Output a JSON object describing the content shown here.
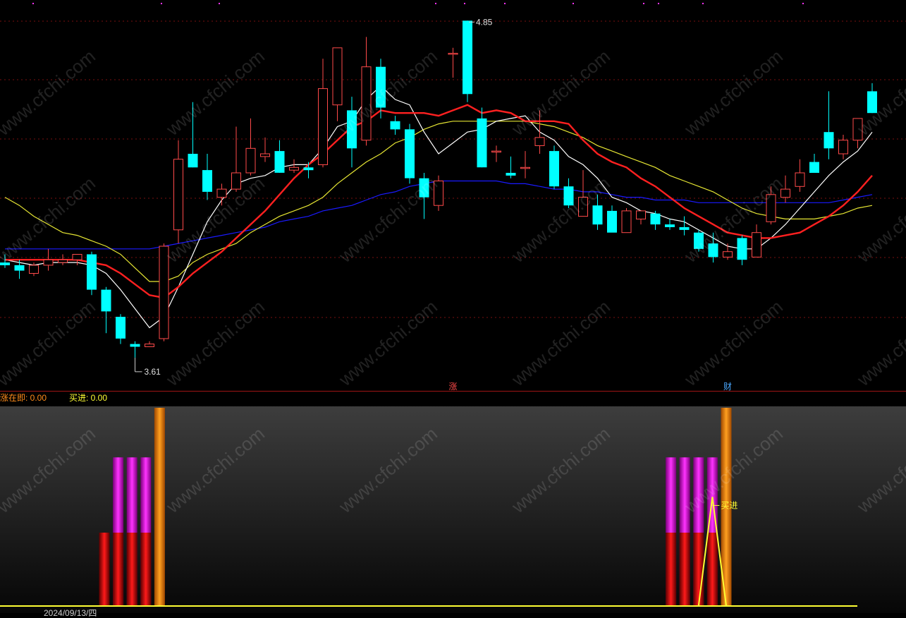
{
  "chart_data": [
    {
      "type": "candlestick",
      "ylim": [
        3.55,
        4.9
      ],
      "annotations": {
        "high_label": "4.85",
        "low_label": "3.61",
        "markers": [
          {
            "index": 31,
            "text": "涨"
          },
          {
            "index": 50,
            "text": "财"
          }
        ]
      },
      "grid": "dotted-horizontal",
      "colors": {
        "up": "#ff4a4a",
        "down": "#00ffff",
        "ma5": "#ffffff",
        "ma10": "#ff2020",
        "ma20": "#e6e633",
        "ma60": "#1a1aff"
      },
      "candles": [
        {
          "o": 3.96,
          "h": 3.99,
          "l": 3.94,
          "c": 3.95
        },
        {
          "o": 3.95,
          "h": 3.97,
          "l": 3.9,
          "c": 3.93
        },
        {
          "o": 3.92,
          "h": 3.96,
          "l": 3.91,
          "c": 3.95
        },
        {
          "o": 3.95,
          "h": 4.01,
          "l": 3.93,
          "c": 3.97
        },
        {
          "o": 3.96,
          "h": 3.99,
          "l": 3.95,
          "c": 3.97
        },
        {
          "o": 3.97,
          "h": 3.99,
          "l": 3.95,
          "c": 3.99
        },
        {
          "o": 3.99,
          "h": 4.0,
          "l": 3.84,
          "c": 3.86
        },
        {
          "o": 3.86,
          "h": 3.87,
          "l": 3.7,
          "c": 3.78
        },
        {
          "o": 3.76,
          "h": 3.77,
          "l": 3.66,
          "c": 3.68
        },
        {
          "o": 3.66,
          "h": 3.67,
          "l": 3.61,
          "c": 3.65
        },
        {
          "o": 3.65,
          "h": 3.67,
          "l": 3.65,
          "c": 3.66
        },
        {
          "o": 3.68,
          "h": 4.03,
          "l": 3.67,
          "c": 4.02
        },
        {
          "o": 4.08,
          "h": 4.41,
          "l": 4.03,
          "c": 4.34
        },
        {
          "o": 4.36,
          "h": 4.55,
          "l": 4.31,
          "c": 4.31
        },
        {
          "o": 4.3,
          "h": 4.36,
          "l": 4.19,
          "c": 4.22
        },
        {
          "o": 4.2,
          "h": 4.25,
          "l": 4.17,
          "c": 4.23
        },
        {
          "o": 4.23,
          "h": 4.46,
          "l": 4.22,
          "c": 4.29
        },
        {
          "o": 4.29,
          "h": 4.49,
          "l": 4.28,
          "c": 4.38
        },
        {
          "o": 4.35,
          "h": 4.42,
          "l": 4.33,
          "c": 4.36
        },
        {
          "o": 4.37,
          "h": 4.41,
          "l": 4.29,
          "c": 4.29
        },
        {
          "o": 4.3,
          "h": 4.34,
          "l": 4.29,
          "c": 4.31
        },
        {
          "o": 4.31,
          "h": 4.33,
          "l": 4.27,
          "c": 4.3
        },
        {
          "o": 4.32,
          "h": 4.71,
          "l": 4.31,
          "c": 4.6
        },
        {
          "o": 4.54,
          "h": 4.75,
          "l": 4.48,
          "c": 4.75
        },
        {
          "o": 4.52,
          "h": 4.57,
          "l": 4.31,
          "c": 4.38
        },
        {
          "o": 4.41,
          "h": 4.79,
          "l": 4.39,
          "c": 4.68
        },
        {
          "o": 4.68,
          "h": 4.71,
          "l": 4.49,
          "c": 4.53
        },
        {
          "o": 4.48,
          "h": 4.5,
          "l": 4.43,
          "c": 4.45
        },
        {
          "o": 4.45,
          "h": 4.47,
          "l": 4.25,
          "c": 4.27
        },
        {
          "o": 4.27,
          "h": 4.29,
          "l": 4.12,
          "c": 4.2
        },
        {
          "o": 4.17,
          "h": 4.28,
          "l": 4.15,
          "c": 4.26
        },
        {
          "o": 4.73,
          "h": 4.75,
          "l": 4.64,
          "c": 4.73
        },
        {
          "o": 4.85,
          "h": 4.85,
          "l": 4.55,
          "c": 4.58
        },
        {
          "o": 4.49,
          "h": 4.53,
          "l": 4.31,
          "c": 4.31
        },
        {
          "o": 4.37,
          "h": 4.39,
          "l": 4.33,
          "c": 4.37
        },
        {
          "o": 4.29,
          "h": 4.35,
          "l": 4.27,
          "c": 4.28
        },
        {
          "o": 4.31,
          "h": 4.37,
          "l": 4.27,
          "c": 4.31
        },
        {
          "o": 4.39,
          "h": 4.52,
          "l": 4.36,
          "c": 4.42
        },
        {
          "o": 4.37,
          "h": 4.39,
          "l": 4.23,
          "c": 4.24
        },
        {
          "o": 4.24,
          "h": 4.27,
          "l": 4.16,
          "c": 4.17
        },
        {
          "o": 4.13,
          "h": 4.3,
          "l": 4.13,
          "c": 4.2
        },
        {
          "o": 4.17,
          "h": 4.21,
          "l": 4.08,
          "c": 4.1
        },
        {
          "o": 4.15,
          "h": 4.17,
          "l": 4.09,
          "c": 4.07
        },
        {
          "o": 4.07,
          "h": 4.16,
          "l": 4.08,
          "c": 4.15
        },
        {
          "o": 4.12,
          "h": 4.15,
          "l": 4.1,
          "c": 4.15
        },
        {
          "o": 4.14,
          "h": 4.15,
          "l": 4.08,
          "c": 4.1
        },
        {
          "o": 4.1,
          "h": 4.12,
          "l": 4.08,
          "c": 4.09
        },
        {
          "o": 4.09,
          "h": 4.13,
          "l": 4.06,
          "c": 4.08
        },
        {
          "o": 4.07,
          "h": 4.08,
          "l": 4.0,
          "c": 4.01
        },
        {
          "o": 4.03,
          "h": 4.07,
          "l": 3.96,
          "c": 3.98
        },
        {
          "o": 3.98,
          "h": 4.03,
          "l": 3.97,
          "c": 4.0
        },
        {
          "o": 4.05,
          "h": 4.06,
          "l": 3.95,
          "c": 3.97
        },
        {
          "o": 3.98,
          "h": 4.1,
          "l": 3.98,
          "c": 4.07
        },
        {
          "o": 4.11,
          "h": 4.24,
          "l": 4.1,
          "c": 4.21
        },
        {
          "o": 4.2,
          "h": 4.28,
          "l": 4.18,
          "c": 4.23
        },
        {
          "o": 4.24,
          "h": 4.34,
          "l": 4.22,
          "c": 4.29
        },
        {
          "o": 4.33,
          "h": 4.36,
          "l": 4.3,
          "c": 4.29
        },
        {
          "o": 4.44,
          "h": 4.59,
          "l": 4.34,
          "c": 4.38
        },
        {
          "o": 4.36,
          "h": 4.43,
          "l": 4.34,
          "c": 4.41
        },
        {
          "o": 4.41,
          "h": 4.49,
          "l": 4.38,
          "c": 4.49
        },
        {
          "o": 4.59,
          "h": 4.62,
          "l": 4.51,
          "c": 4.51
        }
      ],
      "ma5": [
        3.97,
        3.96,
        3.95,
        3.96,
        3.96,
        3.96,
        3.95,
        3.92,
        3.86,
        3.79,
        3.72,
        3.76,
        3.87,
        3.99,
        4.11,
        4.19,
        4.25,
        4.27,
        4.28,
        4.31,
        4.32,
        4.32,
        4.38,
        4.46,
        4.48,
        4.56,
        4.61,
        4.56,
        4.54,
        4.44,
        4.36,
        4.4,
        4.44,
        4.45,
        4.48,
        4.49,
        4.5,
        4.44,
        4.41,
        4.35,
        4.32,
        4.27,
        4.2,
        4.18,
        4.15,
        4.14,
        4.12,
        4.11,
        4.08,
        4.05,
        4.02,
        4.01,
        4.01,
        4.05,
        4.1,
        4.16,
        4.22,
        4.28,
        4.33,
        4.37,
        4.44
      ],
      "ma10": [
        3.97,
        3.97,
        3.97,
        3.97,
        3.97,
        3.97,
        3.96,
        3.95,
        3.92,
        3.88,
        3.84,
        3.83,
        3.87,
        3.92,
        3.96,
        4.0,
        4.05,
        4.1,
        4.15,
        4.21,
        4.27,
        4.32,
        4.36,
        4.41,
        4.46,
        4.48,
        4.52,
        4.51,
        4.51,
        4.51,
        4.5,
        4.52,
        4.54,
        4.51,
        4.52,
        4.51,
        4.48,
        4.48,
        4.48,
        4.47,
        4.41,
        4.36,
        4.33,
        4.31,
        4.27,
        4.24,
        4.2,
        4.16,
        4.13,
        4.1,
        4.07,
        4.06,
        4.05,
        4.05,
        4.06,
        4.07,
        4.1,
        4.13,
        4.17,
        4.22,
        4.28
      ],
      "ma20": [
        4.2,
        4.17,
        4.13,
        4.1,
        4.07,
        4.06,
        4.04,
        4.02,
        3.99,
        3.94,
        3.89,
        3.89,
        3.91,
        3.96,
        3.99,
        4.01,
        4.03,
        4.07,
        4.1,
        4.13,
        4.15,
        4.17,
        4.2,
        4.25,
        4.29,
        4.33,
        4.36,
        4.4,
        4.42,
        4.45,
        4.47,
        4.48,
        4.48,
        4.48,
        4.48,
        4.48,
        4.48,
        4.47,
        4.46,
        4.44,
        4.42,
        4.39,
        4.37,
        4.35,
        4.33,
        4.31,
        4.28,
        4.26,
        4.24,
        4.22,
        4.19,
        4.16,
        4.14,
        4.13,
        4.12,
        4.12,
        4.12,
        4.13,
        4.14,
        4.16,
        4.17
      ],
      "ma60": [
        4.01,
        4.01,
        4.01,
        4.01,
        4.01,
        4.01,
        4.01,
        4.01,
        4.01,
        4.01,
        4.01,
        4.02,
        4.03,
        4.04,
        4.05,
        4.06,
        4.07,
        4.08,
        4.09,
        4.11,
        4.12,
        4.13,
        4.15,
        4.16,
        4.17,
        4.19,
        4.21,
        4.22,
        4.24,
        4.25,
        4.26,
        4.26,
        4.26,
        4.26,
        4.26,
        4.25,
        4.25,
        4.24,
        4.23,
        4.23,
        4.22,
        4.22,
        4.21,
        4.2,
        4.2,
        4.19,
        4.19,
        4.19,
        4.18,
        4.18,
        4.18,
        4.18,
        4.18,
        4.18,
        4.18,
        4.18,
        4.18,
        4.18,
        4.19,
        4.2,
        4.21
      ]
    },
    {
      "type": "bar",
      "legend": [
        {
          "label": "涨在即: 0.00",
          "color": "#ff8c1a"
        },
        {
          "label": "买进: 0.00",
          "color": "#ffff33"
        }
      ],
      "ylim": [
        0,
        1
      ],
      "annotation": "买进",
      "red_bars": [
        {
          "index": 7,
          "value": 0.37
        },
        {
          "index": 8,
          "value": 0.37
        },
        {
          "index": 9,
          "value": 0.37
        },
        {
          "index": 10,
          "value": 0.37
        },
        {
          "index": 48,
          "value": 0.37
        },
        {
          "index": 49,
          "value": 0.37
        },
        {
          "index": 50,
          "value": 0.37
        },
        {
          "index": 51,
          "value": 0.37
        }
      ],
      "magenta_bars": [
        {
          "index": 8,
          "value": 0.75
        },
        {
          "index": 9,
          "value": 0.75
        },
        {
          "index": 10,
          "value": 0.75
        },
        {
          "index": 48,
          "value": 0.75
        },
        {
          "index": 49,
          "value": 0.75
        },
        {
          "index": 50,
          "value": 0.75
        },
        {
          "index": 51,
          "value": 0.75
        }
      ],
      "orange_bars": [
        {
          "index": 11,
          "value": 1.0
        },
        {
          "index": 52,
          "value": 1.0
        }
      ],
      "buy_line": [
        {
          "index": 50,
          "value": 0
        },
        {
          "index": 51,
          "value": 0.55
        },
        {
          "index": 52,
          "value": 0
        }
      ]
    }
  ],
  "watermark": {
    "text": "www.cfchi.com"
  },
  "footer": {
    "date_text": "2024/09/13/四"
  }
}
